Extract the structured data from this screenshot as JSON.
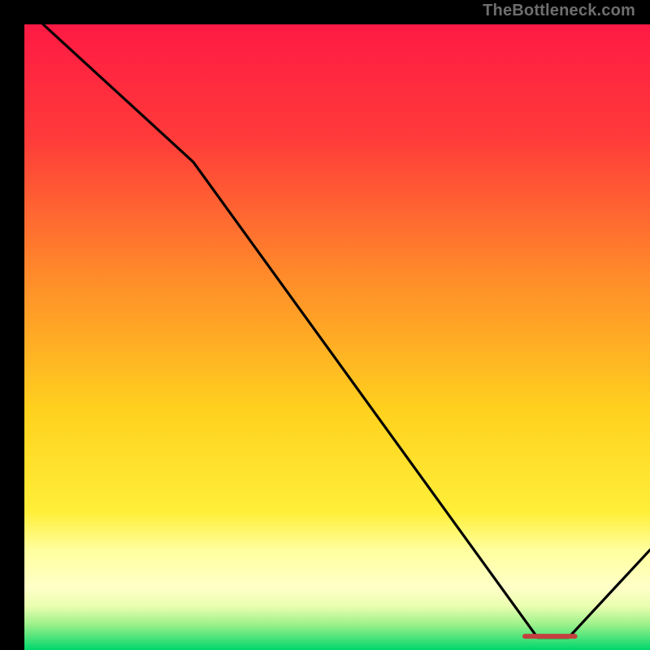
{
  "watermark": "TheBottleneck.com",
  "colors": {
    "gradient_top": "#ff1a44",
    "gradient_mid1": "#ff6a2a",
    "gradient_mid2": "#ffd21e",
    "gradient_band_light": "#ffff9e",
    "gradient_bottom": "#00d76b",
    "line": "#000000",
    "marker": "#c3403f",
    "frame": "#000000"
  },
  "chart_data": {
    "type": "line",
    "title": "",
    "xlabel": "",
    "ylabel": "",
    "xlim": [
      0,
      100
    ],
    "ylim": [
      0,
      100
    ],
    "series": [
      {
        "name": "bottleneck-curve",
        "x": [
          3,
          27,
          82,
          87,
          100
        ],
        "y": [
          100,
          78,
          2,
          2,
          16
        ]
      }
    ],
    "marker": {
      "name": "highlight-segment",
      "x_start": 80,
      "x_end": 88,
      "y": 2.2
    },
    "bands": [
      {
        "name": "light-yellow-band",
        "y_start": 8,
        "y_end": 22
      },
      {
        "name": "green-band",
        "y_start": 0,
        "y_end": 5
      }
    ]
  }
}
